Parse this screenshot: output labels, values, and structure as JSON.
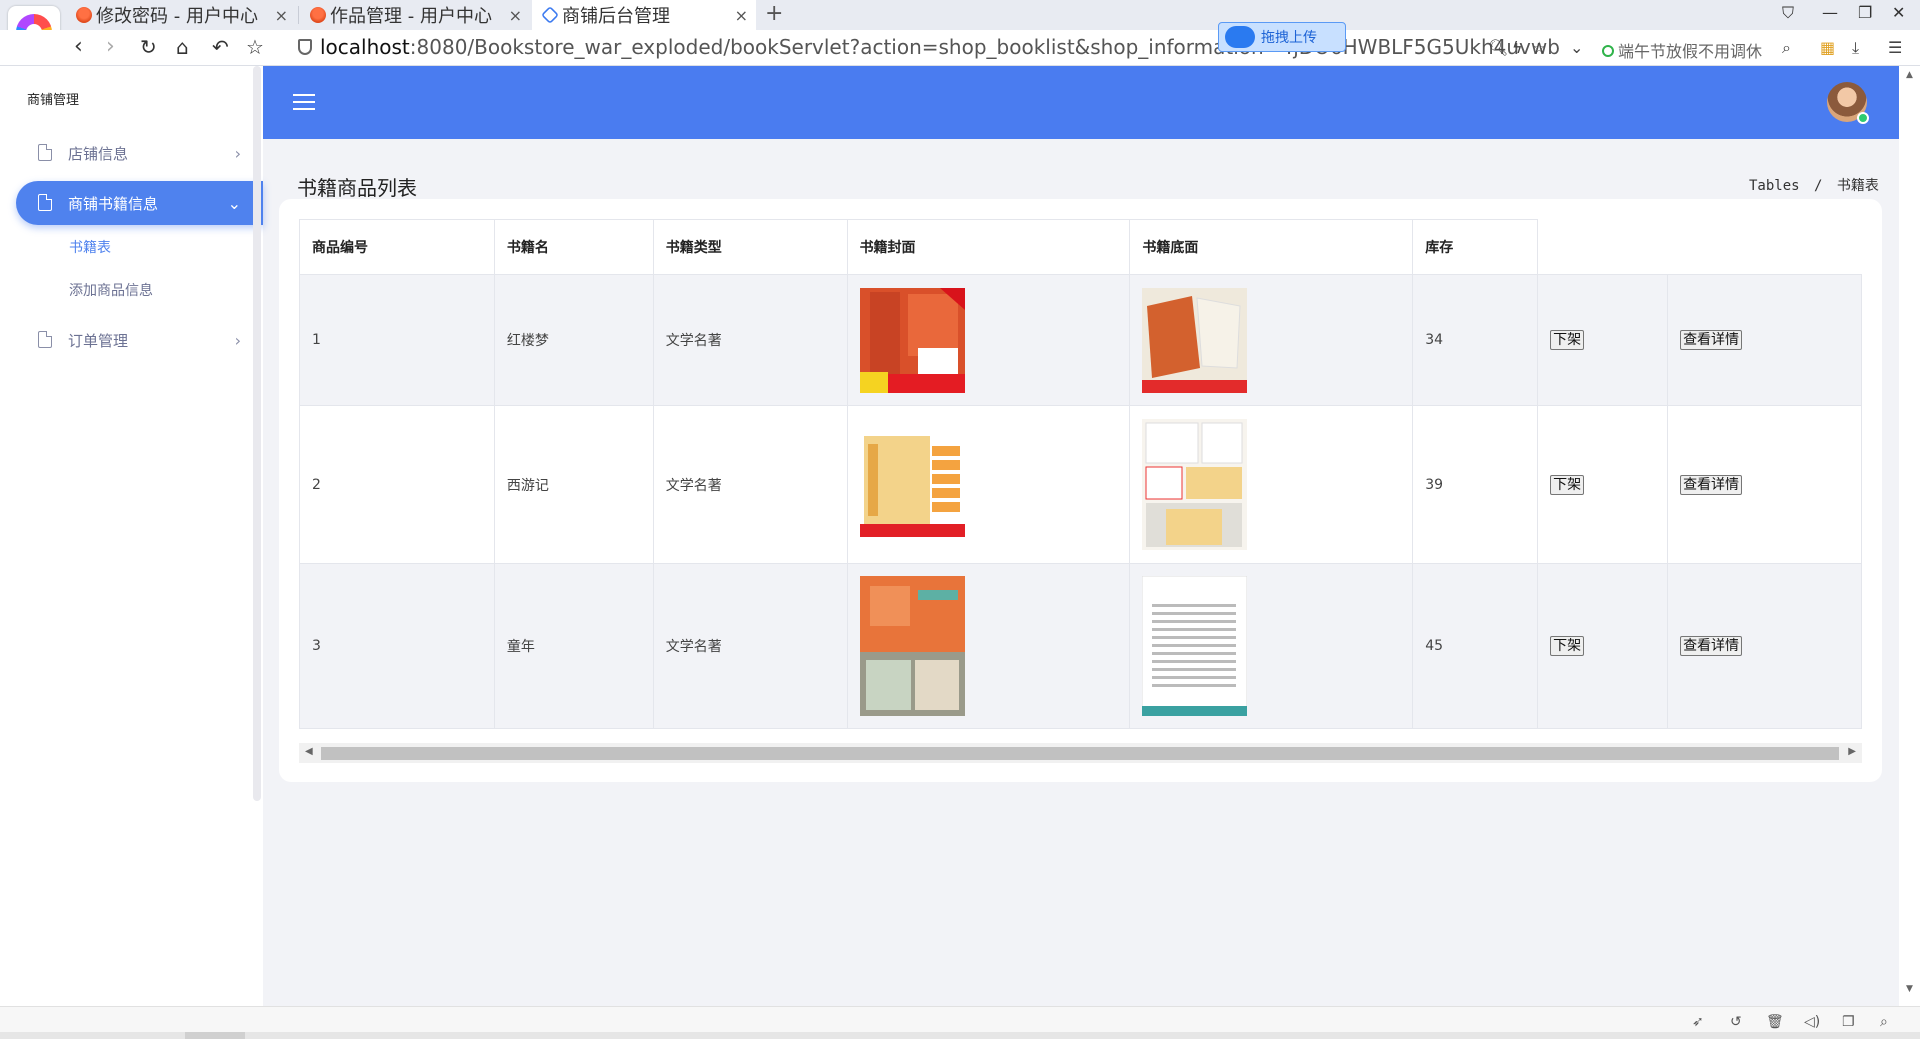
{
  "browser": {
    "tabs": [
      {
        "label": "修改密码 - 用户中心",
        "favicon": "orange-logo-icon"
      },
      {
        "label": "作品管理 - 用户中心",
        "favicon": "orange-logo-icon"
      },
      {
        "label": "商铺后台管理",
        "favicon": "blue-link-icon"
      }
    ],
    "url_host": "localhost",
    "url_rest": ":8080/Bookstore_war_exploded/bookServlet?action=shop_booklist&shop_information=4jDO6HWBLF5G5Ukh4uvwb",
    "upload_badge": "拖拽上传",
    "search_hint": "端午节放假不用调休"
  },
  "sidebar": {
    "brand": "商铺管理",
    "items": [
      {
        "label": "店铺信息",
        "expanded": false
      },
      {
        "label": "商铺书籍信息",
        "expanded": true
      },
      {
        "label": "订单管理",
        "expanded": false
      }
    ],
    "sub_items": [
      {
        "label": "书籍表",
        "current": true
      },
      {
        "label": "添加商品信息",
        "current": false
      }
    ]
  },
  "page": {
    "title": "书籍商品列表",
    "breadcrumb_parent": "Tables",
    "breadcrumb_sep": "/",
    "breadcrumb_current": "书籍表"
  },
  "table": {
    "headers": [
      "商品编号",
      "书籍名",
      "书籍类型",
      "书籍封面",
      "书籍底面",
      "库存"
    ],
    "rows": [
      {
        "id": "1",
        "name": "红楼梦",
        "type": "文学名著",
        "stock": "34",
        "off_shelf": "下架",
        "detail": "查看详情"
      },
      {
        "id": "2",
        "name": "西游记",
        "type": "文学名著",
        "stock": "39",
        "off_shelf": "下架",
        "detail": "查看详情"
      },
      {
        "id": "3",
        "name": "童年",
        "type": "文学名著",
        "stock": "45",
        "off_shelf": "下架",
        "detail": "查看详情"
      }
    ]
  },
  "colors": {
    "header_blue": "#4a7cf0",
    "active_item": "#4f82ee",
    "content_bg": "#f2f3f7"
  }
}
